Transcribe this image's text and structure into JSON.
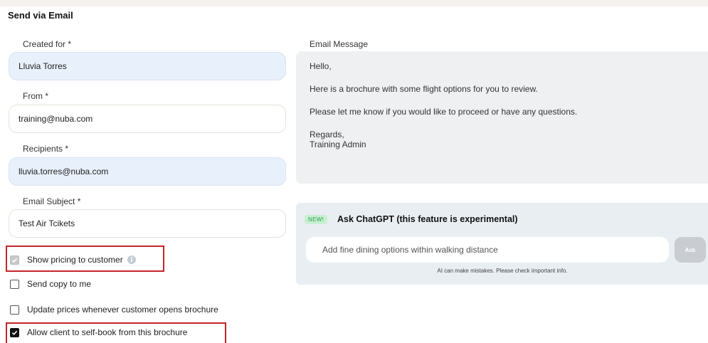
{
  "page_title": "Send via Email",
  "created_for": {
    "label": "Created for *",
    "value": "Lluvia Torres"
  },
  "from": {
    "label": "From *",
    "value": "training@nuba.com"
  },
  "recipients": {
    "label": "Recipients *",
    "value": "lluvia.torres@nuba.com"
  },
  "email_subject": {
    "label": "Email Subject *",
    "value": "Test Air Tcikets"
  },
  "email_message": {
    "label": "Email Message",
    "lines": [
      "Hello,",
      "Here is a brochure with some flight options for you to review.",
      "Please let me know if you would like to proceed or have any questions.",
      "Regards,",
      "Training Admin"
    ]
  },
  "chatgpt": {
    "badge": "NEW!",
    "title": "Ask ChatGPT (this feature is experimental)",
    "input_value": "Add fine dining options within walking distance",
    "ask_label": "Ask",
    "disclaimer": "AI can make mistakes. Please check important info."
  },
  "options": [
    {
      "label": "Show pricing to customer",
      "checked": true,
      "disabled": true
    },
    {
      "label": "Send copy to me",
      "checked": false
    },
    {
      "label": "Update prices whenever customer opens brochure",
      "checked": false
    },
    {
      "label": "Allow client to self-book from this brochure",
      "checked": true
    }
  ],
  "colors": {
    "highlight": "#c3252b",
    "blue_field": "#e8f0fb",
    "new_badge": "#c8efd2"
  }
}
